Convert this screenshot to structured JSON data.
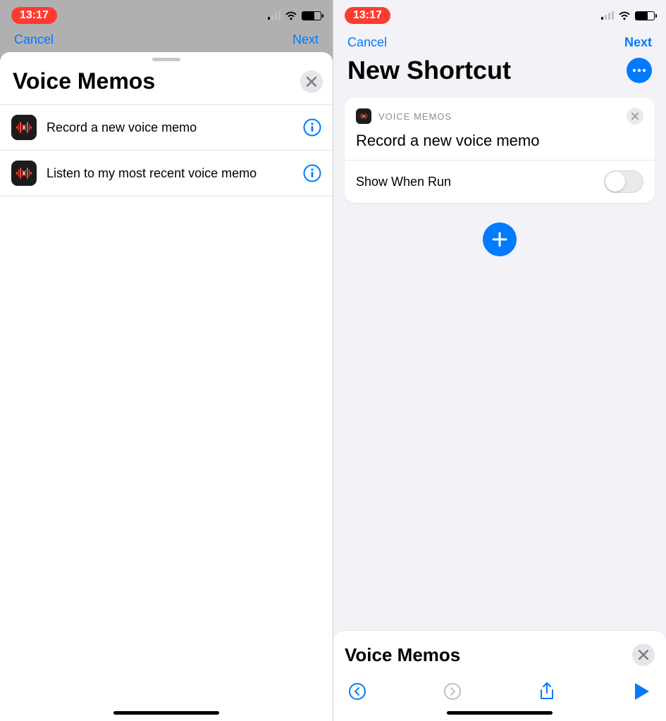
{
  "status": {
    "time": "13:17"
  },
  "left": {
    "behind": {
      "cancel": "Cancel",
      "next": "Next"
    },
    "sheet": {
      "title": "Voice Memos",
      "actions": [
        {
          "label": "Record a new voice memo"
        },
        {
          "label": "Listen to my most recent voice memo"
        }
      ]
    }
  },
  "right": {
    "nav": {
      "cancel": "Cancel",
      "next": "Next"
    },
    "title": "New Shortcut",
    "card": {
      "source": "VOICE MEMOS",
      "action_title": "Record a new voice memo",
      "option_label": "Show When Run",
      "option_on": false
    },
    "bottom_sheet": {
      "title": "Voice Memos"
    }
  }
}
